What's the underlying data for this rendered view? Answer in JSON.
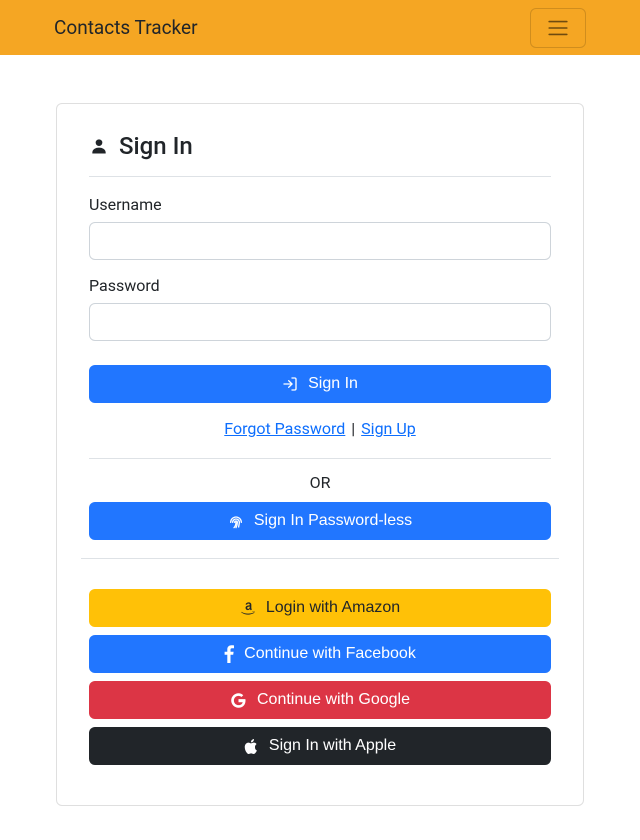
{
  "navbar": {
    "brand": "Contacts Tracker"
  },
  "card": {
    "title": "Sign In"
  },
  "form": {
    "username_label": "Username",
    "username_value": "",
    "password_label": "Password",
    "password_value": "",
    "signin_button": "Sign In",
    "forgot_link": "Forgot Password",
    "separator": "|",
    "signup_link": "Sign Up",
    "or_text": "OR",
    "passwordless_button": "Sign In Password-less"
  },
  "oauth": {
    "amazon": "Login with Amazon",
    "facebook": "Continue with Facebook",
    "google": "Continue with Google",
    "apple": "Sign In with Apple"
  }
}
